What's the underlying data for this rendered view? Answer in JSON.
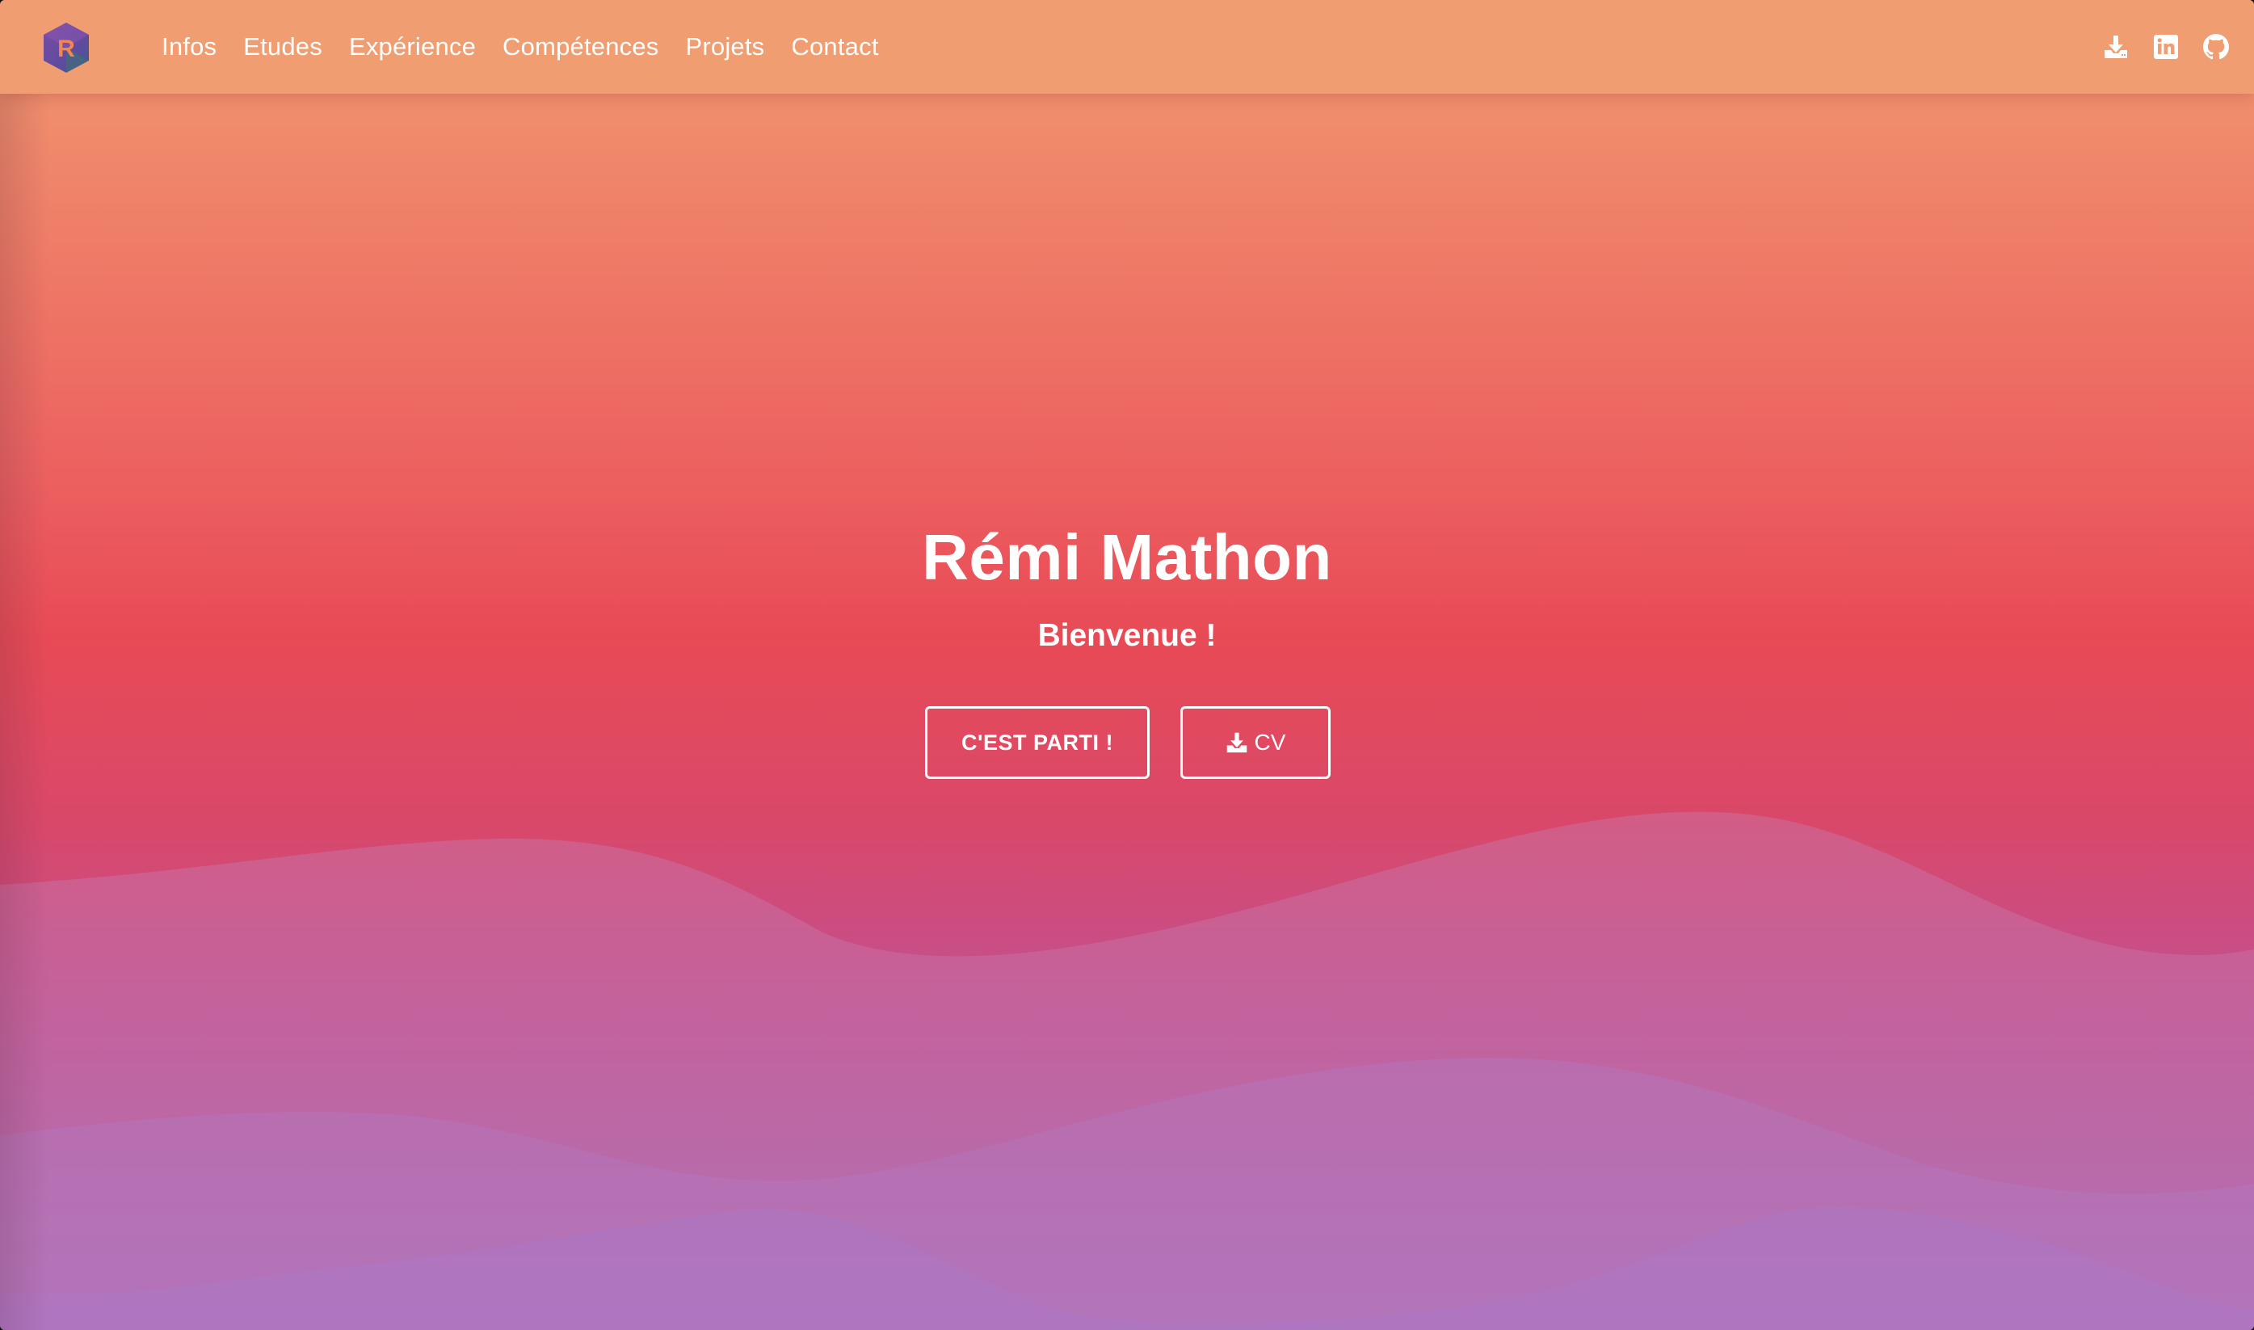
{
  "nav": {
    "logo_letter": "R",
    "links": [
      "Infos",
      "Etudes",
      "Expérience",
      "Compétences",
      "Projets",
      "Contact"
    ],
    "icons": [
      "download-icon",
      "linkedin-icon",
      "github-icon"
    ]
  },
  "hero": {
    "title": "Rémi Mathon",
    "subtitle": "Bienvenue !",
    "primary_button": "C'EST PARTI !",
    "cv_button": "CV",
    "cv_button_icon": "download-icon"
  },
  "colors": {
    "navbar": "#f09d72",
    "gradient_top": "#f09a70",
    "gradient_middle": "#e84a55",
    "gradient_bottom": "#a06fc2",
    "logo_purple": "#6b4a9a",
    "logo_orange": "#f07a50",
    "text": "#ffffff"
  }
}
